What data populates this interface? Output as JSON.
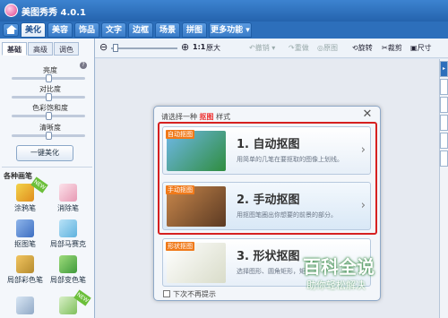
{
  "app": {
    "title": "美图秀秀 4.0.1"
  },
  "menu": {
    "tabs": [
      "美化",
      "美容",
      "饰品",
      "文字",
      "边框",
      "场景",
      "拼图",
      "更多功能"
    ],
    "active": "美化"
  },
  "left_panel": {
    "subtabs": [
      "基础",
      "高级",
      "调色"
    ],
    "sliders": [
      {
        "label": "亮度",
        "level": 0.5
      },
      {
        "label": "对比度",
        "level": 0.5
      },
      {
        "label": "色彩饱和度",
        "level": 0.5
      },
      {
        "label": "清晰度",
        "level": 0.5
      }
    ],
    "beautify_button": "一键美化",
    "pens_title": "各种画笔",
    "tools": [
      "涂鸦笔",
      "消除笔",
      "抠图笔",
      "局部马赛克",
      "局部彩色笔",
      "局部变色笔"
    ]
  },
  "toolbar": {
    "zoom_label": "1:1",
    "enlarge": "原大",
    "undo": "撤销",
    "redo": "重做",
    "original": "原图",
    "rotate": "旋转",
    "crop": "裁剪",
    "size": "尺寸"
  },
  "dialog": {
    "title_prefix": "请选择一种",
    "title_highlight": "抠图",
    "title_suffix": "样式",
    "close": "✕",
    "options": [
      {
        "tag": "自动抠图",
        "title": "1. 自动抠图",
        "desc": "用简单的几笔在要抠取的图像上划线。"
      },
      {
        "tag": "手动抠图",
        "title": "2. 手动抠图",
        "desc": "用抠图笔圈出你想要的前景的部分。"
      },
      {
        "tag": "形状抠图",
        "title": "3. 形状抠图",
        "desc": "选择图形、圆角矩形，矩"
      }
    ],
    "no_more_prompt": "下次不再提示"
  },
  "watermark": {
    "title": "百科全说",
    "subtitle": "助你轻松解决"
  },
  "colors": {
    "titlebar": "#2563ad",
    "highlight_frame": "#d62020",
    "tag": "#f07a1a"
  }
}
